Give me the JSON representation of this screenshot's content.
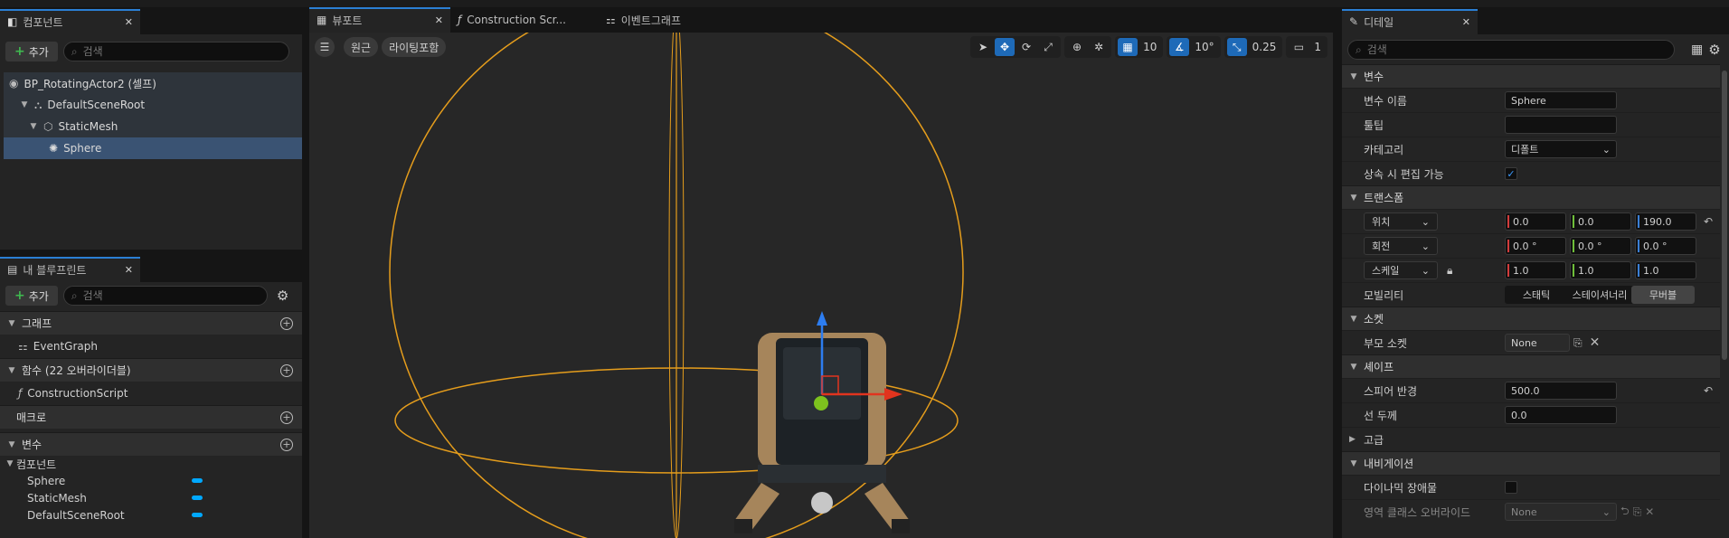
{
  "components_panel": {
    "tab_label": "컴포넌트",
    "add_label": "추가",
    "search_placeholder": "검색",
    "tree": [
      {
        "label": "BP_RotatingActor2 (셀프)"
      },
      {
        "label": "DefaultSceneRoot"
      },
      {
        "label": "StaticMesh"
      },
      {
        "label": "Sphere"
      }
    ]
  },
  "blueprint_panel": {
    "tab_label": "내 블루프린트",
    "add_label": "추가",
    "search_placeholder": "검색",
    "sections": {
      "graph": "그래프",
      "graph_item": "EventGraph",
      "functions": "함수 (22 오버라이더블)",
      "function_item": "ConstructionScript",
      "macros": "매크로",
      "variables": "변수",
      "variables_sub": "컴포넌트"
    },
    "variables": [
      "Sphere",
      "StaticMesh",
      "DefaultSceneRoot"
    ]
  },
  "viewport": {
    "tabs": [
      "뷰포트",
      "Construction Scr...",
      "이벤트그래프"
    ],
    "perspective_label": "원근",
    "lighting_label": "라이팅포함",
    "grid_snap": "10",
    "rotation_snap": "10°",
    "scale_snap": "0.25",
    "camera_speed": "1"
  },
  "details": {
    "tab_label": "디테일",
    "search_placeholder": "검색",
    "sec_variable": "변수",
    "var_name_label": "변수 이름",
    "var_name_value": "Sphere",
    "tooltip_label": "툴팁",
    "category_label": "카테고리",
    "category_value": "디폴트",
    "inherit_label": "상속 시 편집 가능",
    "sec_transform": "트랜스폼",
    "location_label": "위치",
    "location": [
      "0.0",
      "0.0",
      "190.0"
    ],
    "rotation_label": "회전",
    "rotation": [
      "0.0 °",
      "0.0 °",
      "0.0 °"
    ],
    "scale_label": "스케일",
    "scale": [
      "1.0",
      "1.0",
      "1.0"
    ],
    "mobility_label": "모빌리티",
    "mobility_options": [
      "스태틱",
      "스테이셔너리",
      "무버블"
    ],
    "sec_socket": "소켓",
    "parent_socket_label": "부모 소켓",
    "parent_socket_value": "None",
    "sec_shape": "셰이프",
    "sphere_radius_label": "스피어 반경",
    "sphere_radius_value": "500.0",
    "line_thickness_label": "선 두께",
    "line_thickness_value": "0.0",
    "sec_advanced": "고급",
    "sec_navigation": "내비게이션",
    "dynamic_obstacle_label": "다이나믹 장애물",
    "area_class_label": "영역 클래스 오버라이드",
    "area_class_value": "None"
  }
}
